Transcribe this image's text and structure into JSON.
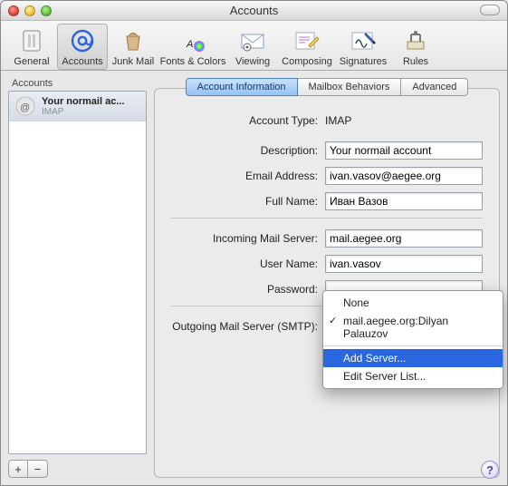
{
  "window": {
    "title": "Accounts"
  },
  "toolbar": {
    "items": [
      {
        "label": "General"
      },
      {
        "label": "Accounts"
      },
      {
        "label": "Junk Mail"
      },
      {
        "label": "Fonts & Colors"
      },
      {
        "label": "Viewing"
      },
      {
        "label": "Composing"
      },
      {
        "label": "Signatures"
      },
      {
        "label": "Rules"
      }
    ]
  },
  "sidebar": {
    "heading": "Accounts",
    "items": [
      {
        "title": "Your normail ac...",
        "subtitle": "IMAP"
      }
    ],
    "add": "+",
    "remove": "−"
  },
  "tabs": {
    "items": [
      "Account Information",
      "Mailbox Behaviors",
      "Advanced"
    ],
    "active": 0
  },
  "form": {
    "account_type_label": "Account Type:",
    "account_type_value": "IMAP",
    "description_label": "Description:",
    "description_value": "Your normail account",
    "email_label": "Email Address:",
    "email_value": "ivan.vasov@aegee.org",
    "fullname_label": "Full Name:",
    "fullname_value": "Иван Вазов",
    "incoming_label": "Incoming Mail Server:",
    "incoming_value": "mail.aegee.org",
    "username_label": "User Name:",
    "username_value": "ivan.vasov",
    "password_label": "Password:",
    "password_value": "",
    "smtp_label": "Outgoing Mail Server (SMTP):"
  },
  "smtp_menu": {
    "options": [
      "None",
      "mail.aegee.org:Dilyan Palauzov",
      "Add Server...",
      "Edit Server List..."
    ],
    "checked_index": 1,
    "highlight_index": 2
  },
  "help": "?"
}
